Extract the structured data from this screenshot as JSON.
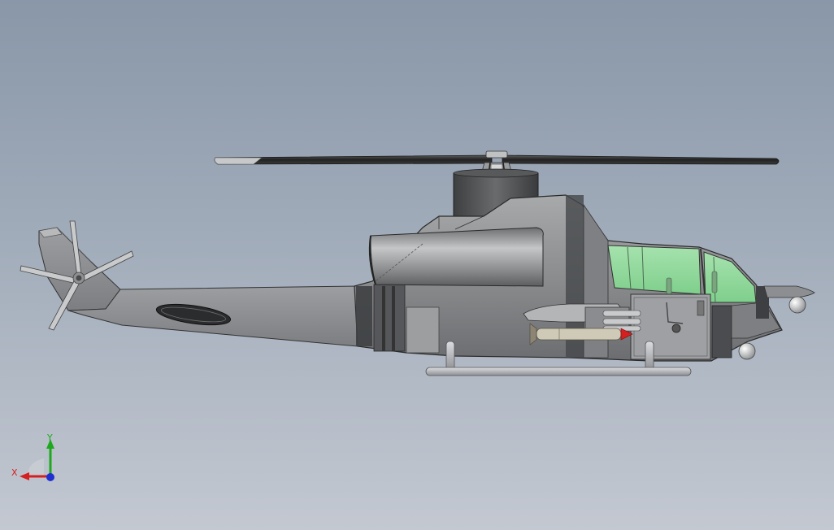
{
  "viewport": {
    "background_top": "#8997a8",
    "background_bottom": "#c3c8d1"
  },
  "model": {
    "body_color": "#8c8e90",
    "canopy_color": "#8fd89a",
    "rotor_color": "#2e2e2e",
    "missile_tip_color": "#d42020"
  },
  "triad": {
    "x_label": "X",
    "y_label": "Y",
    "x_color": "#d42020",
    "y_color": "#1ea81e",
    "z_color": "#2030d0"
  }
}
